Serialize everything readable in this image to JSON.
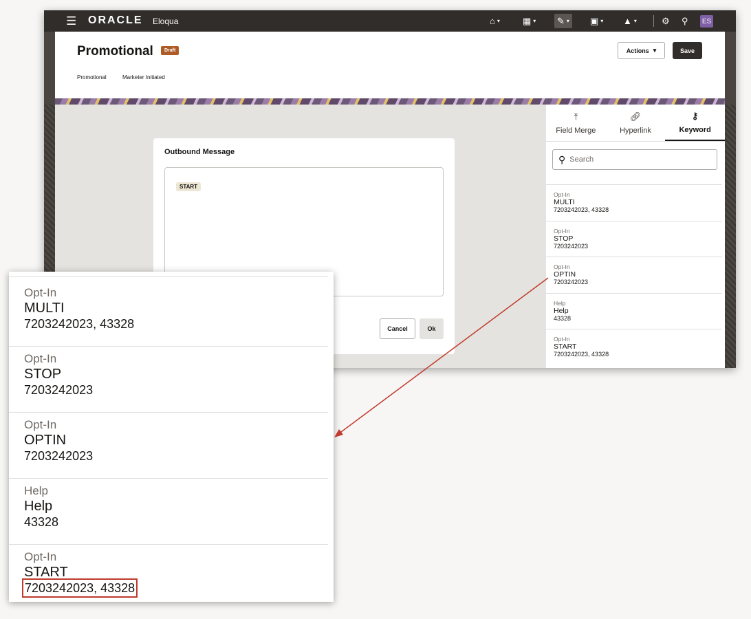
{
  "topbar": {
    "logo": "ORACLE",
    "product": "Eloqua",
    "user_initials": "ES"
  },
  "header": {
    "title": "Promotional",
    "badge": "Draft",
    "meta_type": "Promotional",
    "meta_initiation": "Marketer Initiated",
    "actions_label": "Actions",
    "save_label": "Save"
  },
  "dialog": {
    "title": "Outbound Message",
    "chip": "START",
    "cancel_label": "Cancel",
    "ok_label": "Ok"
  },
  "panel": {
    "tabs": [
      {
        "label": "Field Merge",
        "icon": "field-merge-icon"
      },
      {
        "label": "Hyperlink",
        "icon": "link-icon"
      },
      {
        "label": "Keyword",
        "icon": "key-icon"
      }
    ],
    "active_tab": "Keyword",
    "search_placeholder": "Search",
    "keywords": [
      {
        "type": "Opt-In",
        "name": "MULTI",
        "value": "7203242023, 43328"
      },
      {
        "type": "Opt-In",
        "name": "STOP",
        "value": "7203242023"
      },
      {
        "type": "Opt-In",
        "name": "OPTIN",
        "value": "7203242023"
      },
      {
        "type": "Help",
        "name": "Help",
        "value": "43328"
      },
      {
        "type": "Opt-In",
        "name": "START",
        "value": "7203242023, 43328"
      }
    ]
  },
  "callout": {
    "highlight_color": "#c0392b"
  },
  "colors": {
    "topbar": "#312d2a",
    "badge": "#ae5c27",
    "avatar": "#7f5fa5",
    "arrow": "#c0392b"
  }
}
